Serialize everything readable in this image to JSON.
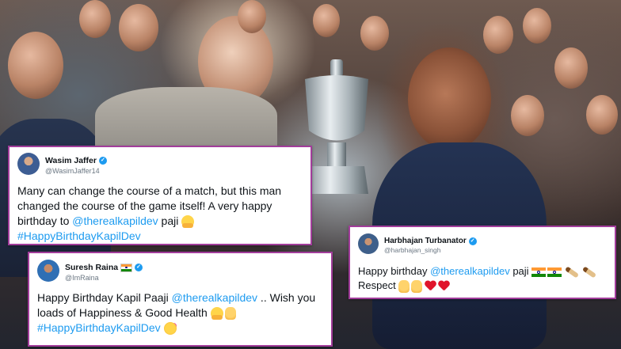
{
  "tweets": {
    "jaffer": {
      "name": "Wasim Jaffer",
      "handle": "@WasimJaffer14",
      "text_1": "Many can change the course of a match, but this man changed the course of the game itself! A very happy birthday to ",
      "mention": "@therealkapildev",
      "text_2": " paji ",
      "hashtag": "#HappyBirthdayKapilDev"
    },
    "raina": {
      "name": "Suresh Raina",
      "handle": "@ImRaina",
      "text_1": "Happy Birthday Kapil Paaji ",
      "mention": "@therealkapildev",
      "text_2": " .. Wish you loads of Happiness & Good Health ",
      "hashtag": "#HappyBirthdayKapilDev"
    },
    "harbhajan": {
      "name": "Harbhajan Turbanator",
      "handle": "@harbhajan_singh",
      "text_1": "Happy birthday ",
      "mention": "@therealkapildev",
      "text_2": " paji ",
      "text_3": "Respect "
    }
  },
  "icons": {
    "verified": "verified-badge-icon",
    "flag": "india-flag-icon",
    "hug": "hugging-face-emoji",
    "clap": "raising-hands-emoji",
    "party": "partying-face-emoji",
    "bat": "cricket-bat-emoji",
    "heart": "red-heart-emoji",
    "pray": "folded-hands-emoji"
  },
  "colors": {
    "card_border": "#a23d9b",
    "link": "#1d9bf0",
    "verified": "#1d9bf0"
  }
}
